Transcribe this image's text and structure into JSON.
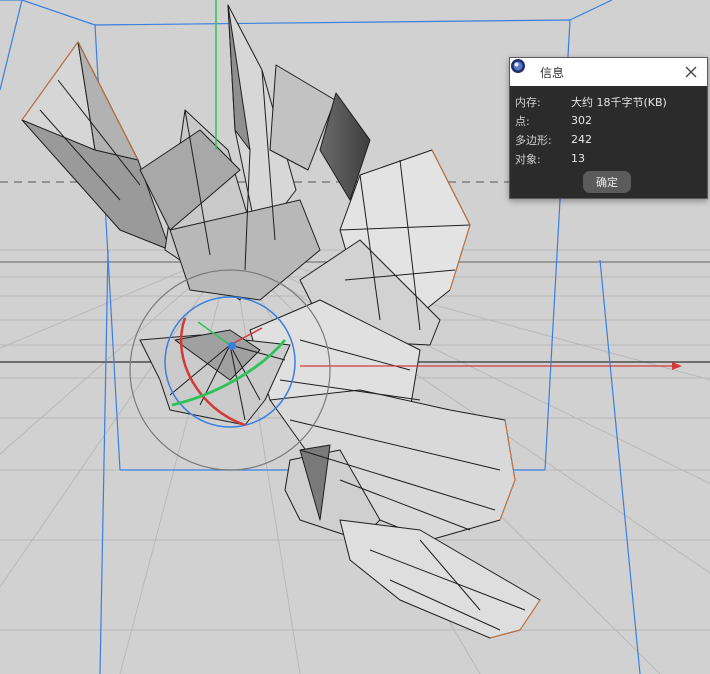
{
  "dialog": {
    "title": "信息",
    "app_icon": "cinema4d-icon",
    "close_icon": "close-icon",
    "rows": [
      {
        "key": "内存:",
        "value": "大约 18千字节(KB)"
      },
      {
        "key": "点:",
        "value": "302"
      },
      {
        "key": "多边形:",
        "value": "242"
      },
      {
        "key": "对象:",
        "value": "13"
      }
    ],
    "ok_label": "确定"
  },
  "viewport": {
    "background_color": "#cfcfcf",
    "x_axis_color": "#d23a3a",
    "y_axis_color": "#2fc25a",
    "bounding_box_color": "#3a7fe0",
    "gizmo_ring_color": "#3a7fe0"
  }
}
